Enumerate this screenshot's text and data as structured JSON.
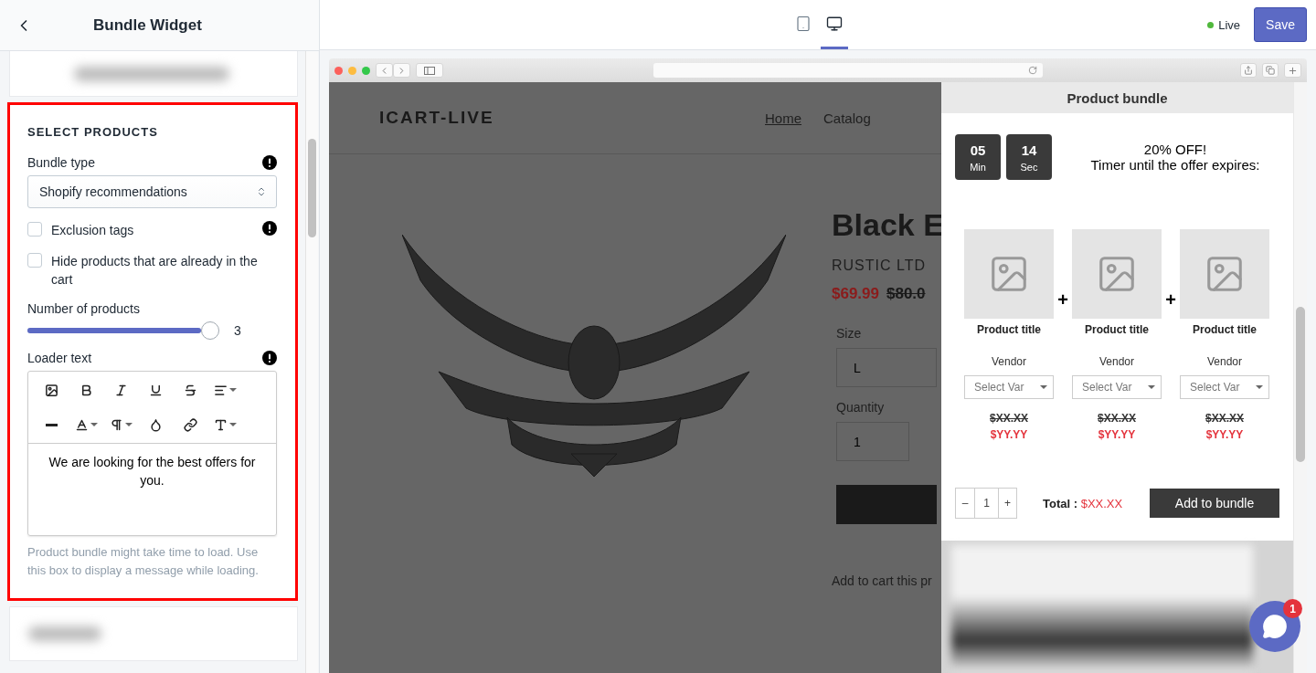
{
  "sidebar": {
    "title": "Bundle Widget",
    "section": {
      "heading": "SELECT PRODUCTS",
      "bundle_type": {
        "label": "Bundle type",
        "value": "Shopify recommendations"
      },
      "options": [
        {
          "label": "Exclusion tags",
          "checked": false,
          "info": true
        },
        {
          "label": "Hide products that are already in the cart",
          "checked": false,
          "info": false
        }
      ],
      "number_of_products": {
        "label": "Number of products",
        "level": 1,
        "reading": "3"
      },
      "loader_text": {
        "label": "Loader text",
        "value": "We are looking for the best offers for you.",
        "help": "Product bundle might take time to load. Use this box to display a message while loading."
      }
    }
  },
  "topbar": {
    "devices": [
      {
        "kind": "tablet",
        "selected": false
      },
      {
        "kind": "desktop",
        "selected": true
      }
    ],
    "status": "Live",
    "save": "Save"
  },
  "store": {
    "logo": "ICART-LIVE",
    "nav": [
      {
        "label": "Home",
        "selected": true
      },
      {
        "label": "Catalog",
        "selected": false
      }
    ],
    "title": "Black E",
    "vendor": "RUSTIC LTD",
    "price": "$69.99",
    "compare_price": "$80.0",
    "size": {
      "label": "Size",
      "value": "L"
    },
    "quantity": {
      "label": "Quantity",
      "value": "1"
    },
    "note": "Add to cart this pr"
  },
  "bundle": {
    "title": "Product bundle",
    "timer": [
      {
        "value": "05",
        "unit": "Min"
      },
      {
        "value": "14",
        "unit": "Sec"
      }
    ],
    "offer": {
      "headline": "20% OFF!",
      "text": "Timer until the offer expires:"
    },
    "separator": "+",
    "products": [
      {
        "title": "Product title",
        "vendor": "Vendor",
        "variant": "Select Var",
        "compare_price": "$XX.XX",
        "price": "$YY.YY"
      },
      {
        "title": "Product title",
        "vendor": "Vendor",
        "variant": "Select Var",
        "compare_price": "$XX.XX",
        "price": "$YY.YY"
      },
      {
        "title": "Product title",
        "vendor": "Vendor",
        "variant": "Select Var",
        "compare_price": "$XX.XX",
        "price": "$YY.YY"
      }
    ],
    "stepper": {
      "minus": "–",
      "value": "1",
      "plus": "+"
    },
    "total": {
      "label": "Total :",
      "value": "$XX.XX"
    },
    "button": "Add to bundle"
  },
  "chat": {
    "badge": "1"
  }
}
